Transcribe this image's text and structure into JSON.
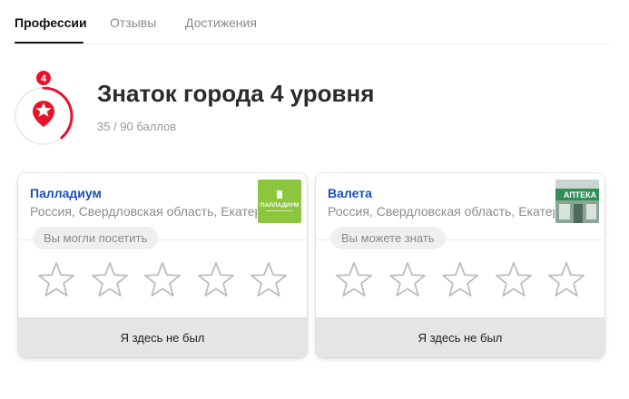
{
  "tabs": [
    {
      "label": "Профессии",
      "active": true
    },
    {
      "label": "Отзывы",
      "active": false
    },
    {
      "label": "Достижения",
      "active": false
    }
  ],
  "achievement": {
    "level_number": "4",
    "title": "Знаток города 4 уровня",
    "points": "35 / 90 баллов",
    "progress": 0.39,
    "accent_color": "#e8132a"
  },
  "places": [
    {
      "name": "Палладиум",
      "address": "Россия, Свердловская область, Екатеринбург",
      "hint": "Вы могли посетить",
      "thumb_text": "ПАЛЛАДИУМ",
      "thumb_color": "#8cc63f",
      "rating": 0,
      "stars": 5,
      "button": "Я здесь не был"
    },
    {
      "name": "Валета",
      "address": "Россия, Свердловская область, Екатеринбург",
      "hint": "Вы можете знать",
      "thumb_text": "АПТЕКА",
      "thumb_color": "#2f8f56",
      "rating": 0,
      "stars": 5,
      "button": "Я здесь не был"
    }
  ],
  "colors": {
    "link": "#1a4fb5",
    "muted": "#8c8c8c",
    "star_outline": "#bdbdbd"
  },
  "icons": {
    "badge": "star-badge-icon",
    "rating": "star-outline-icon"
  }
}
